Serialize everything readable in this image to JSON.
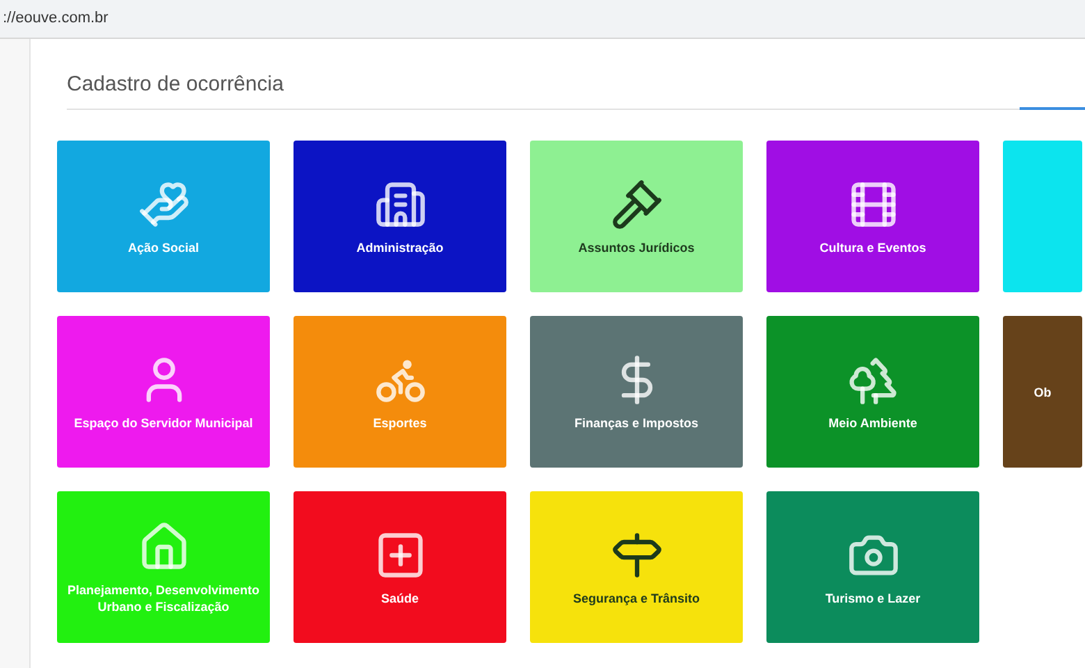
{
  "address_bar": {
    "url": "://eouve.com.br"
  },
  "page": {
    "title": "Cadastro de ocorrência"
  },
  "tiles": [
    {
      "label": "Ação Social",
      "color": "#12a8e0"
    },
    {
      "label": "Administração",
      "color": "#0c14c4"
    },
    {
      "label": "Assuntos Jurídicos",
      "color": "#8ef092"
    },
    {
      "label": "Cultura e Eventos",
      "color": "#a00ee4"
    },
    {
      "color": "#0ce4ee"
    },
    {
      "label": "Espaço do Servidor Municipal",
      "color": "#ee1aee"
    },
    {
      "label": "Esportes",
      "color": "#f48c0c"
    },
    {
      "label": "Finanças e Impostos",
      "color": "#5c7474"
    },
    {
      "label": "Meio Ambiente",
      "color": "#0c9228"
    },
    {
      "label": "Ob",
      "color": "#66421a"
    },
    {
      "label": "Planejamento, Desenvolvimento Urbano e Fiscalização",
      "color": "#22f010"
    },
    {
      "label": "Saúde",
      "color": "#f20c1e"
    },
    {
      "label": "Segurança e Trânsito",
      "color": "#f6e20c"
    },
    {
      "label": "Turismo e Lazer",
      "color": "#0c8c5c"
    }
  ]
}
